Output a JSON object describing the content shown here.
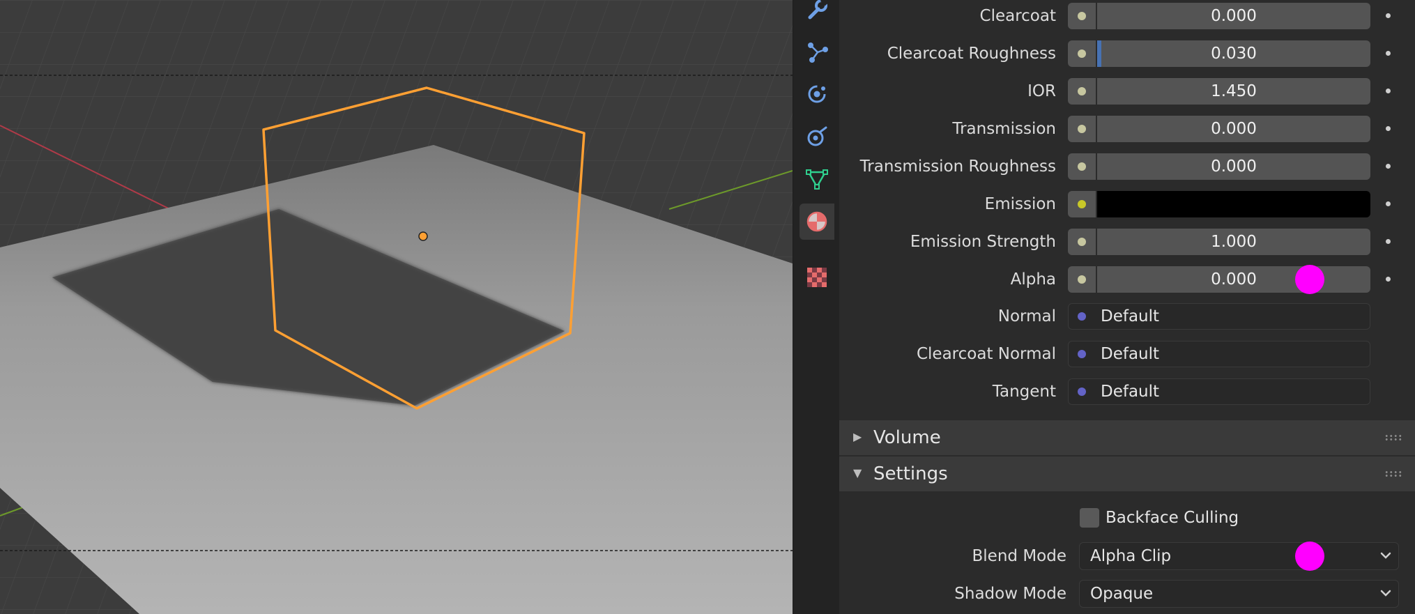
{
  "viewport": {
    "label": "3D Viewport",
    "selected_object": "Cube"
  },
  "tabs": [
    {
      "name": "wrench-icon",
      "label": "Modifier Properties"
    },
    {
      "name": "particles-icon",
      "label": "Particle Properties"
    },
    {
      "name": "physics-icon",
      "label": "Physics Properties"
    },
    {
      "name": "constraint-icon",
      "label": "Object Constraint Properties"
    },
    {
      "name": "mesh-data-icon",
      "label": "Object Data Properties"
    },
    {
      "name": "material-icon",
      "label": "Material Properties",
      "active": true
    },
    {
      "name": "texture-icon",
      "label": "Texture Properties"
    }
  ],
  "properties": {
    "clearcoat": {
      "label": "Clearcoat",
      "value": "0.000",
      "fraction": 0.0
    },
    "clearcoat_roughness": {
      "label": "Clearcoat Roughness",
      "value": "0.030",
      "fraction": 0.03
    },
    "ior": {
      "label": "IOR",
      "value": "1.450"
    },
    "transmission": {
      "label": "Transmission",
      "value": "0.000",
      "fraction": 0.0
    },
    "transmission_roughness": {
      "label": "Transmission Roughness",
      "value": "0.000",
      "fraction": 0.0
    },
    "emission": {
      "label": "Emission",
      "color": "#000000"
    },
    "emission_strength": {
      "label": "Emission Strength",
      "value": "1.000"
    },
    "alpha": {
      "label": "Alpha",
      "value": "0.000",
      "fraction": 0.0
    },
    "normal": {
      "label": "Normal",
      "value": "Default"
    },
    "clearcoat_normal": {
      "label": "Clearcoat Normal",
      "value": "Default"
    },
    "tangent": {
      "label": "Tangent",
      "value": "Default"
    }
  },
  "panels": {
    "volume": {
      "title": "Volume",
      "expanded": false
    },
    "settings": {
      "title": "Settings",
      "expanded": true
    }
  },
  "settings": {
    "backface_culling": {
      "label": "Backface Culling",
      "checked": false
    },
    "blend_mode": {
      "label": "Blend Mode",
      "value": "Alpha Clip"
    },
    "shadow_mode": {
      "label": "Shadow Mode",
      "value": "Opaque"
    }
  },
  "colors": {
    "socket_float": "#c7c7a0",
    "socket_color": "#c8c828",
    "socket_vector": "#6363c7",
    "selection_outline": "#ffa033",
    "cursor_marker": "#ff00ff",
    "slider_fill": "#4772b3"
  }
}
